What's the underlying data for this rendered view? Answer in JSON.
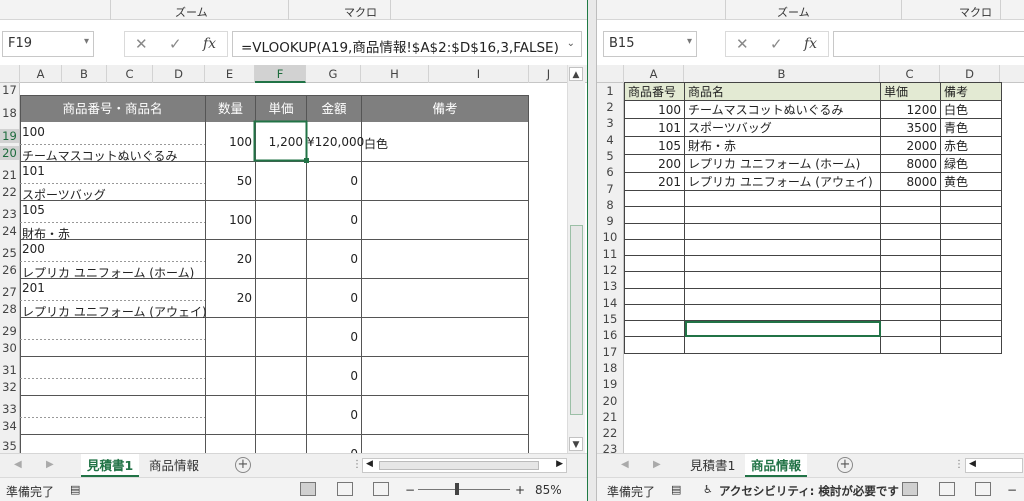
{
  "left": {
    "ribbon": {
      "zoom": "ズーム",
      "macro": "マクロ"
    },
    "name_box": "F19",
    "formula": "=VLOOKUP(A19,商品情報!$A$2:$D$16,3,FALSE)",
    "columns": [
      "A",
      "B",
      "C",
      "D",
      "E",
      "F",
      "G",
      "H",
      "I",
      "J"
    ],
    "rows": [
      "17",
      "18",
      "19",
      "20",
      "21",
      "22",
      "23",
      "24",
      "25",
      "26",
      "27",
      "28",
      "29",
      "30",
      "31",
      "32",
      "33",
      "34",
      "35"
    ],
    "headers": {
      "item": "商品番号・商品名",
      "qty": "数量",
      "price": "単価",
      "amount": "金額",
      "notes": "備考"
    },
    "items": [
      {
        "no": "100",
        "name": "チームマスコットぬいぐるみ",
        "qty": "100",
        "price": "1,200",
        "amount": "¥120,000",
        "note": "白色"
      },
      {
        "no": "101",
        "name": "スポーツバッグ",
        "qty": "50",
        "price": "",
        "amount": "0",
        "note": ""
      },
      {
        "no": "105",
        "name": "財布・赤",
        "qty": "100",
        "price": "",
        "amount": "0",
        "note": ""
      },
      {
        "no": "200",
        "name": "レプリカ ユニフォーム (ホーム)",
        "qty": "20",
        "price": "",
        "amount": "0",
        "note": ""
      },
      {
        "no": "201",
        "name": "レプリカ ユニフォーム (アウェイ)",
        "qty": "20",
        "price": "",
        "amount": "0",
        "note": ""
      },
      {
        "no": "",
        "name": "",
        "qty": "",
        "price": "",
        "amount": "0",
        "note": ""
      },
      {
        "no": "",
        "name": "",
        "qty": "",
        "price": "",
        "amount": "0",
        "note": ""
      },
      {
        "no": "",
        "name": "",
        "qty": "",
        "price": "",
        "amount": "0",
        "note": ""
      },
      {
        "no": "",
        "name": "",
        "qty": "",
        "price": "",
        "amount": "0",
        "note": ""
      }
    ],
    "tabs": [
      "見積書1",
      "商品情報"
    ],
    "status": "準備完了",
    "zoom_level": "85%"
  },
  "right": {
    "ribbon": {
      "zoom": "ズーム",
      "macro": "マクロ"
    },
    "name_box": "B15",
    "formula": "",
    "columns": [
      "A",
      "B",
      "C",
      "D"
    ],
    "rows": [
      "1",
      "2",
      "3",
      "4",
      "5",
      "6",
      "7",
      "8",
      "9",
      "10",
      "11",
      "12",
      "13",
      "14",
      "15",
      "16",
      "17",
      "18",
      "19",
      "20",
      "21",
      "22",
      "23"
    ],
    "table_header": [
      "商品番号",
      "商品名",
      "単価",
      "備考"
    ],
    "products": [
      [
        "100",
        "チームマスコットぬいぐるみ",
        "1200",
        "白色"
      ],
      [
        "101",
        "スポーツバッグ",
        "3500",
        "青色"
      ],
      [
        "105",
        "財布・赤",
        "2000",
        "赤色"
      ],
      [
        "200",
        "レプリカ ユニフォーム (ホーム)",
        "8000",
        "緑色"
      ],
      [
        "201",
        "レプリカ ユニフォーム (アウェイ)",
        "8000",
        "黄色"
      ],
      [
        "",
        "",
        "",
        ""
      ],
      [
        "",
        "",
        "",
        ""
      ],
      [
        "",
        "",
        "",
        ""
      ],
      [
        "",
        "",
        "",
        ""
      ],
      [
        "",
        "",
        "",
        ""
      ],
      [
        "",
        "",
        "",
        ""
      ],
      [
        "",
        "",
        "",
        ""
      ],
      [
        "",
        "",
        "",
        ""
      ],
      [
        "",
        "",
        "",
        ""
      ],
      [
        "",
        "",
        "",
        ""
      ]
    ],
    "tabs": [
      "見積書1",
      "商品情報"
    ],
    "status": "準備完了",
    "accessibility": "アクセシビリティ: 検討が必要です"
  },
  "colors": {
    "accent": "#217346",
    "header_fill": "#7f7f7f",
    "table_header_fill": "#e3ead3"
  }
}
